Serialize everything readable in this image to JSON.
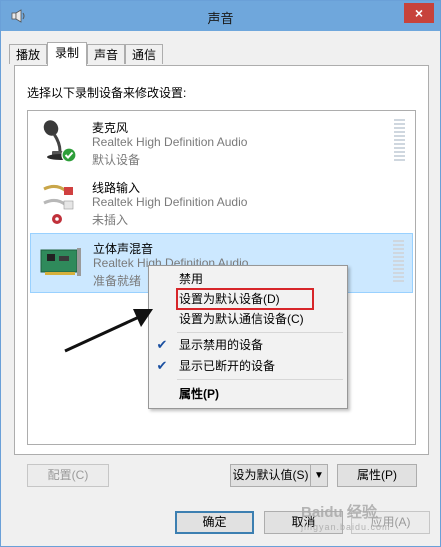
{
  "window": {
    "title": "声音",
    "close_label": "×"
  },
  "tabs": [
    {
      "label": "播放"
    },
    {
      "label": "录制"
    },
    {
      "label": "声音"
    },
    {
      "label": "通信"
    }
  ],
  "panel": {
    "instruction": "选择以下录制设备来修改设置:"
  },
  "devices": [
    {
      "name": "麦克风",
      "driver": "Realtek High Definition Audio",
      "status": "默认设备",
      "icon": "microphone-icon",
      "badge": "check-badge"
    },
    {
      "name": "线路输入",
      "driver": "Realtek High Definition Audio",
      "status": "未插入",
      "icon": "line-in-cable-icon",
      "badge": "unplugged-badge"
    },
    {
      "name": "立体声混音",
      "driver": "Realtek High Definition Audio",
      "status": "准备就绪",
      "icon": "sound-card-icon",
      "selected": true
    }
  ],
  "context_menu": {
    "items": [
      {
        "label": "禁用"
      },
      {
        "label": "设置为默认设备(D)"
      },
      {
        "label": "设置为默认通信设备(C)"
      },
      {
        "label": "显示禁用的设备",
        "checked": true
      },
      {
        "label": "显示已断开的设备",
        "checked": true
      },
      {
        "label": "属性(P)",
        "bold": true
      }
    ],
    "check_glyph": "✔"
  },
  "buttons": {
    "configure": "配置(C)",
    "set_default": "设为默认值(S)",
    "properties": "属性(P)",
    "ok": "确定",
    "cancel": "取消",
    "apply": "应用(A)"
  },
  "watermark": {
    "text": "Baidu 经验",
    "sub": "jingyan.baidu.com"
  },
  "colors": {
    "titlebar": "#6fa7dc",
    "selection": "#cce8ff",
    "highlight_border": "#d7262a",
    "close": "#c7433b"
  }
}
